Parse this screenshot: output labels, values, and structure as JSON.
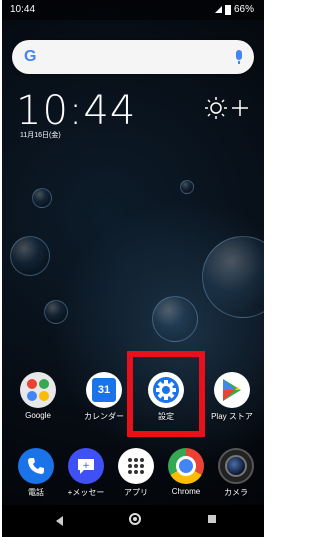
{
  "statusbar": {
    "time": "10:44",
    "battery": "66%"
  },
  "search": {
    "logo": "G",
    "mic_icon": "mic-icon"
  },
  "clock": {
    "time": "10:44",
    "date": "11月16日(金)"
  },
  "weather_icon": "sun-plus-icon",
  "apps_row": [
    {
      "label": "Google",
      "icon": "google-folder-icon"
    },
    {
      "label": "カレンダー",
      "icon": "calendar-icon",
      "badge": "31"
    },
    {
      "label": "設定",
      "icon": "settings-gear-icon"
    },
    {
      "label": "Play ストア",
      "icon": "play-store-icon"
    }
  ],
  "dock": [
    {
      "label": "電話",
      "icon": "phone-icon"
    },
    {
      "label": "+メッセー",
      "icon": "messages-icon"
    },
    {
      "label": "アプリ",
      "icon": "app-drawer-icon"
    },
    {
      "label": "Chrome",
      "icon": "chrome-icon"
    },
    {
      "label": "カメラ",
      "icon": "camera-icon"
    }
  ],
  "colors": {
    "highlight": "#e8101a",
    "google_blue": "#4285f4",
    "settings_blue": "#1a73e8"
  }
}
